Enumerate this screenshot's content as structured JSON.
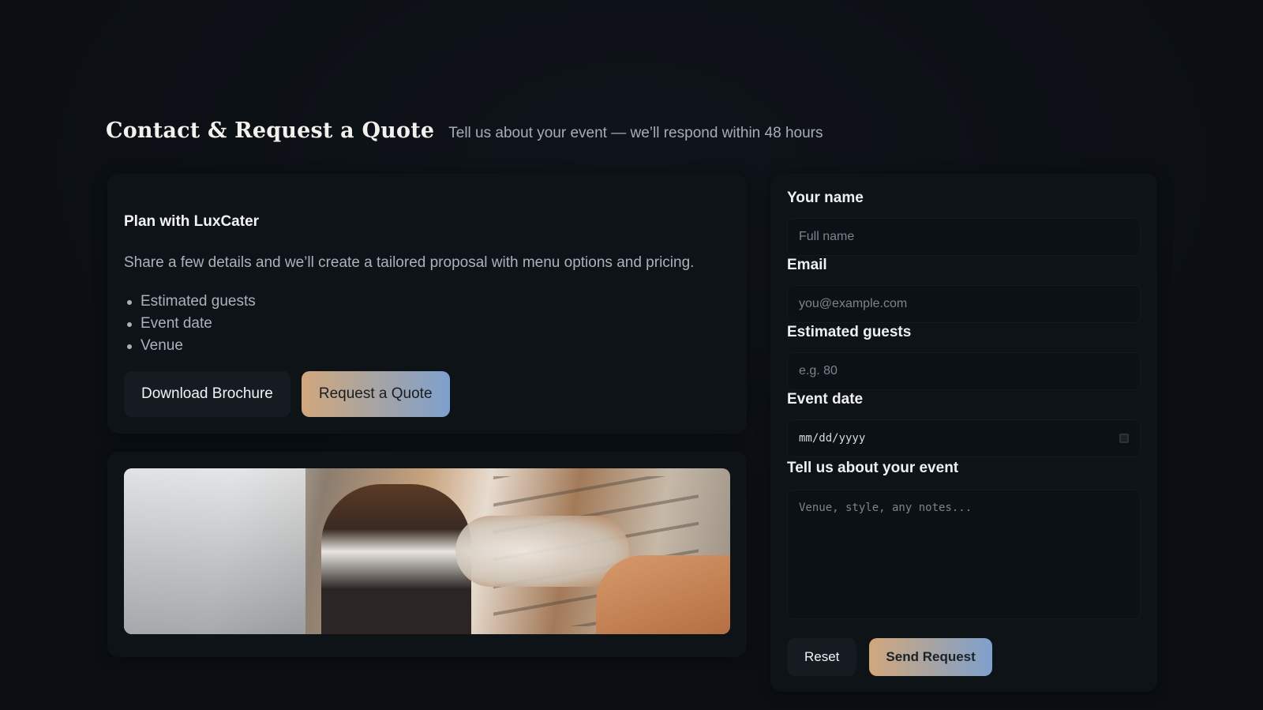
{
  "header": {
    "title": "Contact & Request a Quote",
    "subtitle": "Tell us about your event — we’ll respond within 48 hours"
  },
  "plan": {
    "title": "Plan with LuxCater",
    "description": "Share a few details and we’ll create a tailored proposal with menu options and pricing.",
    "items": [
      "Estimated guests",
      "Event date",
      "Venue"
    ],
    "download_label": "Download Brochure",
    "quote_label": "Request a Quote"
  },
  "form": {
    "name_label": "Your name",
    "name_placeholder": "Full name",
    "email_label": "Email",
    "email_placeholder": "you@example.com",
    "guests_label": "Estimated guests",
    "guests_placeholder": "e.g. 80",
    "date_label": "Event date",
    "date_value": "mm/dd/yyyy",
    "details_label": "Tell us about your event",
    "details_placeholder": "Venue, style, any notes...",
    "reset_label": "Reset",
    "send_label": "Send Request"
  },
  "colors": {
    "background": "#0b0f14",
    "card": "#0e1318",
    "accent_gradient_start": "#d1a77c",
    "accent_gradient_end": "#7ea0cd"
  },
  "icons": {
    "date_picker": "calendar-icon"
  }
}
